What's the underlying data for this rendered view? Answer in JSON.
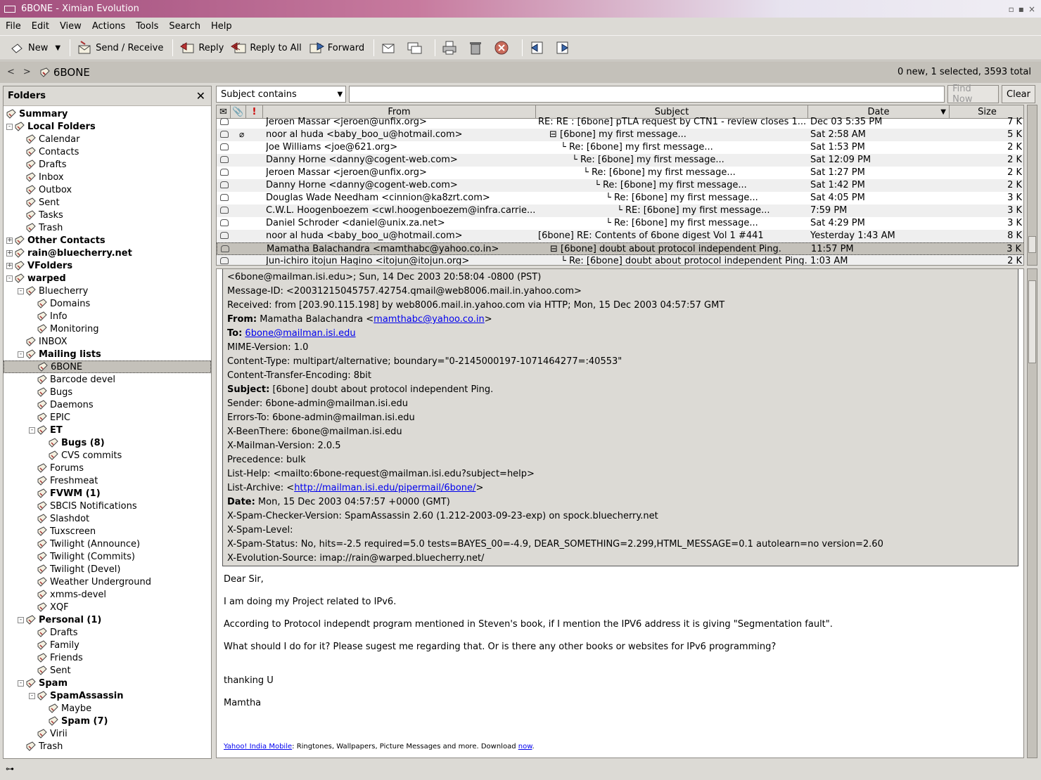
{
  "window": {
    "title": "6BONE - Ximian Evolution"
  },
  "menu": [
    "File",
    "Edit",
    "View",
    "Actions",
    "Tools",
    "Search",
    "Help"
  ],
  "toolbar": {
    "new": "New",
    "send_receive": "Send / Receive",
    "reply": "Reply",
    "reply_all": "Reply to All",
    "forward": "Forward"
  },
  "breadcrumb": {
    "folder": "6BONE",
    "status": "0 new, 1 selected, 3593 total"
  },
  "folders_pane": {
    "title": "Folders"
  },
  "folder_tree": [
    {
      "label": "Summary",
      "bold": true,
      "level": 0
    },
    {
      "label": "Local Folders",
      "bold": true,
      "level": 0,
      "exp": "-"
    },
    {
      "label": "Calendar",
      "level": 1
    },
    {
      "label": "Contacts",
      "level": 1
    },
    {
      "label": "Drafts",
      "level": 1
    },
    {
      "label": "Inbox",
      "level": 1
    },
    {
      "label": "Outbox",
      "level": 1
    },
    {
      "label": "Sent",
      "level": 1
    },
    {
      "label": "Tasks",
      "level": 1
    },
    {
      "label": "Trash",
      "level": 1
    },
    {
      "label": "Other Contacts",
      "bold": true,
      "level": 0,
      "exp": "+"
    },
    {
      "label": "rain@bluecherry.net",
      "bold": true,
      "level": 0,
      "exp": "+"
    },
    {
      "label": "VFolders",
      "bold": true,
      "level": 0,
      "exp": "+"
    },
    {
      "label": "warped",
      "bold": true,
      "level": 0,
      "exp": "-"
    },
    {
      "label": "Bluecherry",
      "level": 1,
      "exp": "-"
    },
    {
      "label": "Domains",
      "level": 2
    },
    {
      "label": "Info",
      "level": 2
    },
    {
      "label": "Monitoring",
      "level": 2
    },
    {
      "label": "INBOX",
      "level": 1
    },
    {
      "label": "Mailing lists",
      "bold": true,
      "level": 1,
      "exp": "-"
    },
    {
      "label": "6BONE",
      "level": 2,
      "selected": true
    },
    {
      "label": "Barcode devel",
      "level": 2
    },
    {
      "label": "Bugs",
      "level": 2
    },
    {
      "label": "Daemons",
      "level": 2
    },
    {
      "label": "EPIC",
      "level": 2
    },
    {
      "label": "ET",
      "bold": true,
      "level": 2,
      "exp": "-"
    },
    {
      "label": "Bugs (8)",
      "bold": true,
      "level": 3
    },
    {
      "label": "CVS commits",
      "level": 3
    },
    {
      "label": "Forums",
      "level": 2
    },
    {
      "label": "Freshmeat",
      "level": 2
    },
    {
      "label": "FVWM (1)",
      "bold": true,
      "level": 2
    },
    {
      "label": "SBCIS Notifications",
      "level": 2
    },
    {
      "label": "Slashdot",
      "level": 2
    },
    {
      "label": "Tuxscreen",
      "level": 2
    },
    {
      "label": "Twilight (Announce)",
      "level": 2
    },
    {
      "label": "Twilight (Commits)",
      "level": 2
    },
    {
      "label": "Twilight (Devel)",
      "level": 2
    },
    {
      "label": "Weather Underground",
      "level": 2
    },
    {
      "label": "xmms-devel",
      "level": 2
    },
    {
      "label": "XQF",
      "level": 2
    },
    {
      "label": "Personal (1)",
      "bold": true,
      "level": 1,
      "exp": "-"
    },
    {
      "label": "Drafts",
      "level": 2
    },
    {
      "label": "Family",
      "level": 2
    },
    {
      "label": "Friends",
      "level": 2
    },
    {
      "label": "Sent",
      "level": 2
    },
    {
      "label": "Spam",
      "bold": true,
      "level": 1,
      "exp": "-"
    },
    {
      "label": "SpamAssassin",
      "bold": true,
      "level": 2,
      "exp": "-"
    },
    {
      "label": "Maybe",
      "level": 3
    },
    {
      "label": "Spam (7)",
      "bold": true,
      "level": 3
    },
    {
      "label": "Virii",
      "level": 2
    },
    {
      "label": "Trash",
      "level": 1
    }
  ],
  "search": {
    "scope": "Subject contains",
    "query": "",
    "find_now": "Find Now",
    "clear": "Clear"
  },
  "columns": {
    "from": "From",
    "subject": "Subject",
    "date": "Date",
    "size": "Size"
  },
  "messages": [
    {
      "from": "Jeroen Massar <jeroen@unfix.org>",
      "subject": "RE: RE : [6bone] pTLA request by CTN1 - review closes 1...",
      "indent": 0,
      "date": "Dec 03 5:35 PM",
      "size": "7 K"
    },
    {
      "from": "noor al huda <baby_boo_u@hotmail.com>",
      "subject": "[6bone] my first message...",
      "indent": 1,
      "date": "Sat 2:58 AM",
      "size": "5 K",
      "attach": true
    },
    {
      "from": "Joe Williams <joe@621.org>",
      "subject": "Re: [6bone] my first message...",
      "indent": 2,
      "date": "Sat 1:53 PM",
      "size": "2 K"
    },
    {
      "from": "Danny Horne <danny@cogent-web.com>",
      "subject": "Re: [6bone] my first message...",
      "indent": 3,
      "date": "Sat 12:09 PM",
      "size": "2 K"
    },
    {
      "from": "Jeroen Massar <jeroen@unfix.org>",
      "subject": "Re: [6bone] my first message...",
      "indent": 4,
      "date": "Sat 1:27 PM",
      "size": "2 K"
    },
    {
      "from": "Danny Horne <danny@cogent-web.com>",
      "subject": "Re: [6bone] my first message...",
      "indent": 5,
      "date": "Sat 1:42 PM",
      "size": "2 K"
    },
    {
      "from": "Douglas Wade Needham <cinnion@ka8zrt.com>",
      "subject": "Re: [6bone] my first message...",
      "indent": 6,
      "date": "Sat 4:05 PM",
      "size": "3 K"
    },
    {
      "from": "C.W.L. Hoogenboezem <cwl.hoogenboezem@infra.carrie...",
      "subject": "RE: [6bone] my first message...",
      "indent": 7,
      "date": "7:59 PM",
      "size": "3 K"
    },
    {
      "from": "Daniel Schroder <daniel@unix.za.net>",
      "subject": "Re: [6bone] my first message...",
      "indent": 6,
      "date": "Sat 4:29 PM",
      "size": "3 K"
    },
    {
      "from": "noor al huda <baby_boo_u@hotmail.com>",
      "subject": "[6bone] RE: Contents of 6bone digest Vol 1 #441",
      "indent": 0,
      "date": "Yesterday 1:43 AM",
      "size": "8 K"
    },
    {
      "from": "Mamatha Balachandra <mamthabc@yahoo.co.in>",
      "subject": "[6bone] doubt about protocol independent Ping.",
      "indent": 1,
      "date": "11:57 PM",
      "size": "3 K",
      "selected": true
    },
    {
      "from": "Jun-ichiro itojun Hagino <itojun@itojun.org>",
      "subject": "Re: [6bone] doubt about protocol independent Ping.",
      "indent": 2,
      "date": "1:03 AM",
      "size": "2 K"
    }
  ],
  "headers": {
    "l1": "<6bone@mailman.isi.edu>; Sun, 14 Dec 2003 20:58:04 -0800 (PST)",
    "l2": "Message-ID:  <20031215045757.42754.qmail@web8006.mail.in.yahoo.com>",
    "l3": "Received:  from [203.90.115.198] by web8006.mail.in.yahoo.com via HTTP; Mon, 15 Dec 2003 04:57:57 GMT",
    "from_label": "From:",
    "from_name": " Mamatha Balachandra <",
    "from_email": "mamthabc@yahoo.co.in",
    "from_end": ">",
    "to_label": "To:",
    "to_email": "6bone@mailman.isi.edu",
    "l6": "MIME-Version:  1.0",
    "l7": "Content-Type:  multipart/alternative; boundary=\"0-2145000197-1071464277=:40553\"",
    "l8": "Content-Transfer-Encoding:  8bit",
    "subject_label": "Subject:",
    "subject": " [6bone] doubt about protocol independent Ping.",
    "l10": "Sender:  6bone-admin@mailman.isi.edu",
    "l11": "Errors-To:  6bone-admin@mailman.isi.edu",
    "l12": "X-BeenThere:  6bone@mailman.isi.edu",
    "l13": "X-Mailman-Version:  2.0.5",
    "l14": "Precedence:  bulk",
    "l15": "List-Help:  <mailto:6bone-request@mailman.isi.edu?subject=help>",
    "archive_label": "List-Archive:  <",
    "archive_url": "http://mailman.isi.edu/pipermail/6bone/",
    "archive_end": ">",
    "date_label": "Date:",
    "date": " Mon, 15 Dec 2003 04:57:57 +0000 (GMT)",
    "l18": "X-Spam-Checker-Version:  SpamAssassin 2.60 (1.212-2003-09-23-exp) on  spock.bluecherry.net",
    "l19": "X-Spam-Level:",
    "l20": "X-Spam-Status:  No, hits=-2.5 required=5.0 tests=BAYES_00=-4.9, DEAR_SOMETHING=2.299,HTML_MESSAGE=0.1 autolearn=no version=2.60",
    "l21": "X-Evolution-Source: imap://rain@warped.bluecherry.net/"
  },
  "body": {
    "p1": "Dear Sir,",
    "p2": "I am doing my Project related to IPv6.",
    "p3": "According to Protocol independt program mentioned in Steven's book, if I mention the IPV6 address it is giving \"Segmentation fault\".",
    "p4": "What should I do for it? Please sugest me regarding that. Or is there any other books or websites for IPv6 programming?",
    "p5": "thanking U",
    "p6": "Mamtha"
  },
  "footer": {
    "link1": "Yahoo! India Mobile",
    "text": ": Ringtones, Wallpapers, Picture Messages and more. Download ",
    "link2": "now",
    "end": "."
  }
}
